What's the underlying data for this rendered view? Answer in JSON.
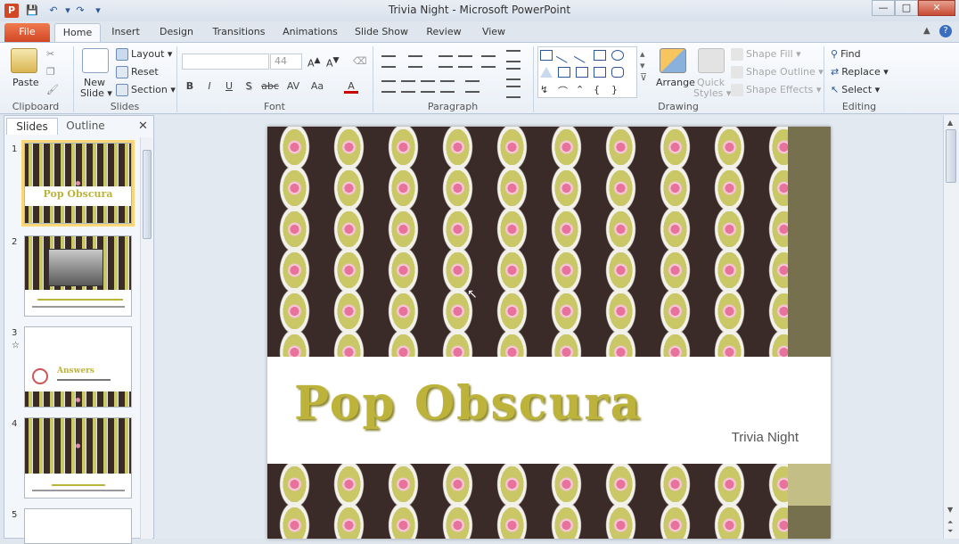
{
  "window": {
    "title": "Trivia Night  -  Microsoft PowerPoint",
    "minimize": "—",
    "maximize": "□",
    "close": "✕"
  },
  "qat": {
    "app_icon": "P",
    "save": "💾",
    "undo": "↶",
    "redo": "↷",
    "customize": "▾"
  },
  "tabs": [
    {
      "label": "File"
    },
    {
      "label": "Home"
    },
    {
      "label": "Insert"
    },
    {
      "label": "Design"
    },
    {
      "label": "Transitions"
    },
    {
      "label": "Animations"
    },
    {
      "label": "Slide Show"
    },
    {
      "label": "Review"
    },
    {
      "label": "View"
    }
  ],
  "ribbon": {
    "clipboard": {
      "label": "Clipboard",
      "paste": "Paste"
    },
    "slides": {
      "label": "Slides",
      "new_slide": "New",
      "new_slide2": "Slide ▾",
      "layout": "Layout ▾",
      "reset": "Reset",
      "section": "Section ▾"
    },
    "font": {
      "label": "Font",
      "size": "44",
      "bold": "B",
      "italic": "I",
      "underline": "U",
      "strike": "S",
      "shadow": "abc",
      "spacing": "AV",
      "case": "Aa",
      "color": "A"
    },
    "paragraph": {
      "label": "Paragraph"
    },
    "drawing": {
      "label": "Drawing",
      "arrange": "Arrange",
      "quick_styles": "Quick",
      "quick_styles2": "Styles ▾",
      "shape_fill": "Shape Fill ▾",
      "shape_outline": "Shape Outline ▾",
      "shape_effects": "Shape Effects ▾"
    },
    "editing": {
      "label": "Editing",
      "find": "Find",
      "replace": "Replace ▾",
      "select": "Select ▾"
    }
  },
  "panel": {
    "tab_slides": "Slides",
    "tab_outline": "Outline",
    "close": "✕",
    "slides": [
      {
        "num": "1"
      },
      {
        "num": "2"
      },
      {
        "num": "3",
        "star": "☆"
      },
      {
        "num": "4"
      },
      {
        "num": "5"
      }
    ],
    "thumb1_title": "Pop Obscura",
    "thumb3_title": "Answers"
  },
  "slide": {
    "title": "Pop Obscura",
    "subtitle": "Trivia Night"
  },
  "colors": {
    "accent_file_tab": "#d24726",
    "title_gold": "#bdb33b",
    "strip_olive": "#76704f",
    "strip_light": "#c3bd86"
  }
}
